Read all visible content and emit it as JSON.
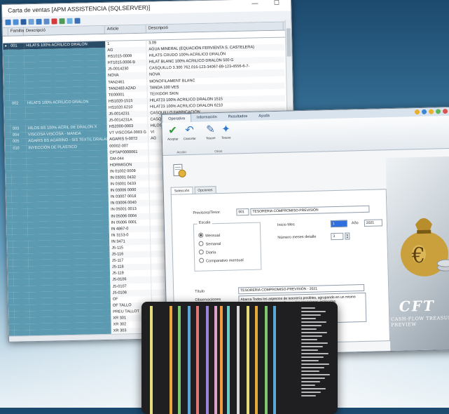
{
  "window1": {
    "title": "Carta de ventas [APM ASSISTENCIA (SQLSERVER)]",
    "controls": "— ☐",
    "columns": [
      "",
      "Familia",
      "Descripció",
      "Article",
      "Descripció"
    ],
    "rows": [
      {
        "fam": "001",
        "fdesc": "HILATS 100% ACRILICO DRALON",
        "art": "1",
        "desc": "3.09",
        "sel": true
      },
      {
        "fam": "",
        "fdesc": "",
        "art": "AG",
        "desc": "AGUA MINERAL (EQUACIÓN FERVIENTA S. CASTELERA)"
      },
      {
        "fam": "",
        "fdesc": "",
        "art": "HS1015-0009",
        "desc": "HILATS CRUDO 100% ACRILICO DRALÓN"
      },
      {
        "fam": "",
        "fdesc": "",
        "art": "HT1015.0006 B",
        "desc": "HILAT BLANC 100% ACRILICO DRALON 500 G"
      },
      {
        "fam": "",
        "fdesc": "",
        "art": "J5-0014230",
        "desc": "CASQUILLO 3.300 762.016-123-34067-89-123-4556-6-7-"
      },
      {
        "fam": "",
        "fdesc": "",
        "art": "NOVA",
        "desc": "NOVA"
      },
      {
        "fam": "",
        "fdesc": "",
        "art": "TAN2461",
        "desc": "MONOFILAMENT BLANC"
      },
      {
        "fam": "",
        "fdesc": "",
        "art": "TAN2483 AZAD",
        "desc": "TANDA 100 VES"
      },
      {
        "fam": "",
        "fdesc": "",
        "art": "TE00001",
        "desc": "TEIXIDOR SKIN"
      },
      {
        "fam": "002",
        "fdesc": "HILATS 100% ACRILICO DRALON",
        "art": "HS1020-1515",
        "desc": "HILAT23 100% ACRILICO DRALON 1515"
      },
      {
        "fam": "",
        "fdesc": "",
        "art": "HS1020.6210",
        "desc": "HILAT23 100% ACRILICO DRALON 6210"
      },
      {
        "fam": "",
        "fdesc": "",
        "art": "J5-0014231",
        "desc": "CASQUILLO FABRICACIÓN"
      },
      {
        "fam": "",
        "fdesc": "",
        "art": "J5-0014231A",
        "desc": "CASQUILLO"
      },
      {
        "fam": "003",
        "fdesc": "HILOS BS 100% ACRIL DE DRALON X",
        "art": "HS2000-0003",
        "desc": "HILOS"
      },
      {
        "fam": "004",
        "fdesc": "VISCOSA VISCOSA - MANDA",
        "art": "VT VISCOSA 0003 G",
        "desc": "VI"
      },
      {
        "fam": "005",
        "fdesc": "AGARIS BS AGARINO - SIS TEXTIL DRALAN",
        "art": "AGARIS 5-0072",
        "desc": "AG"
      },
      {
        "fam": "010",
        "fdesc": "INYECCIÓN DE PLASTICO",
        "art": "00002-007",
        "desc": ""
      },
      {
        "fam": "",
        "fdesc": "",
        "art": "CPTAP0000061",
        "desc": ""
      },
      {
        "fam": "",
        "fdesc": "",
        "art": "GM-044",
        "desc": ""
      },
      {
        "fam": "",
        "fdesc": "",
        "art": "HORMIGON",
        "desc": ""
      },
      {
        "fam": "",
        "fdesc": "",
        "art": "IN 01002 0009",
        "desc": ""
      },
      {
        "fam": "",
        "fdesc": "",
        "art": "IN 03001 0432",
        "desc": ""
      },
      {
        "fam": "",
        "fdesc": "",
        "art": "IN 03001 0433",
        "desc": ""
      },
      {
        "fam": "",
        "fdesc": "",
        "art": "IN 03006 0000",
        "desc": ""
      },
      {
        "fam": "",
        "fdesc": "",
        "art": "IN 03007 0018",
        "desc": ""
      },
      {
        "fam": "",
        "fdesc": "",
        "art": "IN 03006 0040",
        "desc": ""
      },
      {
        "fam": "",
        "fdesc": "",
        "art": "IN 05001 0013",
        "desc": ""
      },
      {
        "fam": "",
        "fdesc": "",
        "art": "IN 05006 0004",
        "desc": ""
      },
      {
        "fam": "",
        "fdesc": "",
        "art": "IN 05006 0001",
        "desc": ""
      },
      {
        "fam": "",
        "fdesc": "",
        "art": "IN 4867-0",
        "desc": ""
      },
      {
        "fam": "",
        "fdesc": "",
        "art": "IN 3153-0",
        "desc": ""
      },
      {
        "fam": "",
        "fdesc": "",
        "art": "IN 3471",
        "desc": ""
      },
      {
        "fam": "",
        "fdesc": "",
        "art": "J5-115",
        "desc": ""
      },
      {
        "fam": "",
        "fdesc": "",
        "art": "J5-116",
        "desc": ""
      },
      {
        "fam": "",
        "fdesc": "",
        "art": "J5-117",
        "desc": ""
      },
      {
        "fam": "",
        "fdesc": "",
        "art": "J5-118",
        "desc": ""
      },
      {
        "fam": "",
        "fdesc": "",
        "art": "J5-119",
        "desc": ""
      },
      {
        "fam": "",
        "fdesc": "",
        "art": "J5-0106",
        "desc": ""
      },
      {
        "fam": "",
        "fdesc": "",
        "art": "J5-0107",
        "desc": ""
      },
      {
        "fam": "",
        "fdesc": "",
        "art": "J5-0108",
        "desc": ""
      },
      {
        "fam": "",
        "fdesc": "",
        "art": "OF",
        "desc": ""
      },
      {
        "fam": "",
        "fdesc": "",
        "art": "OF TALLO",
        "desc": ""
      },
      {
        "fam": "",
        "fdesc": "",
        "art": "PREU TALLOT",
        "desc": ""
      },
      {
        "fam": "",
        "fdesc": "",
        "art": "XR 301",
        "desc": ""
      },
      {
        "fam": "",
        "fdesc": "",
        "art": "XR 302",
        "desc": ""
      },
      {
        "fam": "",
        "fdesc": "",
        "art": "XR 303",
        "desc": ""
      },
      {
        "fam": "",
        "fdesc": "",
        "art": "Z 11",
        "desc": ""
      },
      {
        "fam": "120",
        "fdesc": "EXTRUSIÓN PERFILES PLASTICO",
        "art": "Z 12",
        "desc": ""
      },
      {
        "fam": "130",
        "fdesc": "FABRICACIÓN DE MOLDES",
        "art": "Z 13",
        "desc": ""
      },
      {
        "fam": "140",
        "fdesc": "DISEÑO GRAFICO",
        "art": "14 LCAUS 100",
        "desc": ""
      }
    ]
  },
  "window2": {
    "menu": [
      "Operativa",
      "Información",
      "Resultados",
      "Ayuda"
    ],
    "ribbon": {
      "buttons": [
        "Aceptar",
        "Cancelar",
        "Tesore",
        "Tesore"
      ],
      "groups": [
        "Acción",
        "Otros"
      ]
    },
    "tabs": [
      "Selección",
      "Opciones"
    ],
    "form": {
      "previsora_label": "Previsora/Tesor.",
      "previsora_code": "001",
      "previsora_name": "TESORERIA COMPROMISO-PREVISIÓN",
      "escala_label": "Escala",
      "escala_options": [
        "Mensual",
        "Semanal",
        "Diaria",
        "Comparativo mensual"
      ],
      "inicio_label": "Inicio   Mes",
      "inicio_mes": "1",
      "ano_label": "Año",
      "ano_value": "2021",
      "meses_label": "Número meses detalle",
      "meses_value": "3",
      "titulo_label": "Título",
      "titulo_value": "TESORERIA COMPROMISO-PREVISIÓN - 2021",
      "obs_label": "Observaciones",
      "obs_value": "Abarca Todos los aspectos de tesorería posibles, agrupando en un mismo listado los compromisos en firme y las previsiones estimadas."
    },
    "brand": {
      "logo": "CFT",
      "subtitle": "CASH-FLOW TREASURY PREVIEW"
    }
  },
  "window3": {
    "stripe_colors": [
      "#e4dc7a",
      "#e8a83c",
      "#7ec96e",
      "#5aa7d6",
      "#e07777",
      "#9a84d8",
      "#e0a2c7",
      "#f09b3c",
      "#6bcbc8",
      "#d9d9d9"
    ]
  },
  "colors": {
    "family_col": "#5b9ab1",
    "selected_row": "#2a4b66"
  }
}
